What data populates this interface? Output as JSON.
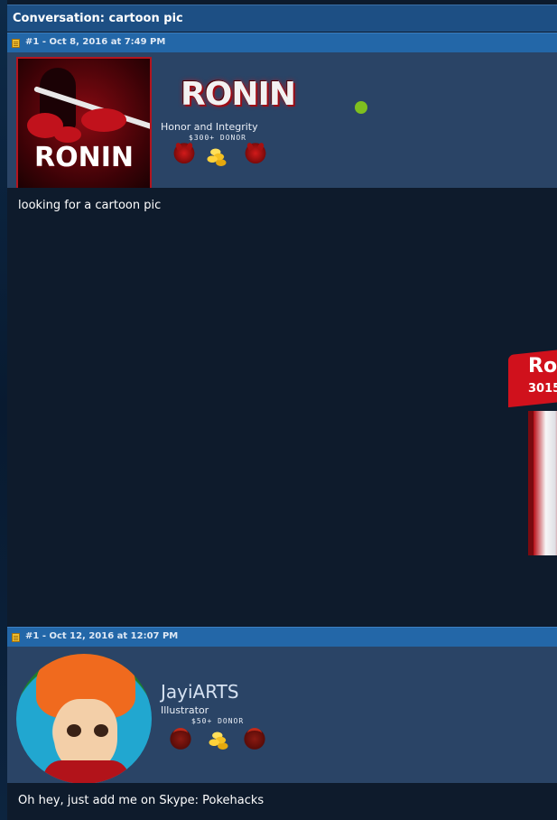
{
  "conversation": {
    "title": "Conversation: cartoon pic"
  },
  "posts": [
    {
      "header": "#1 - Oct 8, 2016 at 7:49 PM",
      "avatar_text": "RONIN",
      "username_logo": "RONIN",
      "user_title": "Honor and Integrity",
      "donor_label": "$300+ DONOR",
      "online": true,
      "message": "looking for a cartoon pic",
      "badges": [
        "demon-icon",
        "coins-icon",
        "demon-icon"
      ],
      "side_banner": {
        "text": "Ro",
        "sub": "3015"
      }
    },
    {
      "header": "#1 - Oct 12, 2016 at 12:07 PM",
      "username": "JayiARTS",
      "user_title": "Illustrator",
      "donor_label": "$50+ DONOR",
      "message": "Oh hey, just add me on Skype: Pokehacks",
      "badges": [
        "claw-icon",
        "coins-icon",
        "claw-icon"
      ]
    }
  ],
  "colors": {
    "title_bar": "#1d4f84",
    "post_header": "#2367a8",
    "userbar": "#2a4466",
    "body": "#0e1b2c",
    "online": "#7fbf1f",
    "brand_red": "#c1121c"
  }
}
